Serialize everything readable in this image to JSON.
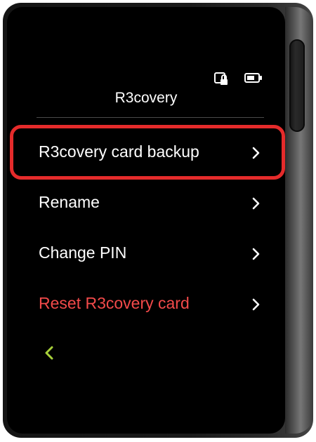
{
  "screen": {
    "title": "R3covery"
  },
  "status": {
    "icons": [
      "card-lock-icon",
      "battery-icon"
    ]
  },
  "menu": {
    "items": [
      {
        "label": "R3covery card backup",
        "danger": false,
        "highlighted": true,
        "icon": "chevron-right-icon"
      },
      {
        "label": "Rename",
        "danger": false,
        "highlighted": false,
        "icon": "chevron-right-icon"
      },
      {
        "label": "Change PIN",
        "danger": false,
        "highlighted": false,
        "icon": "chevron-right-icon"
      },
      {
        "label": "Reset R3covery card",
        "danger": true,
        "highlighted": false,
        "icon": "chevron-right-icon"
      }
    ]
  },
  "nav": {
    "back_icon": "chevron-left-icon"
  },
  "colors": {
    "accent_back": "#a8d13a",
    "danger": "#f24a4a",
    "highlight": "#e52b2b"
  }
}
